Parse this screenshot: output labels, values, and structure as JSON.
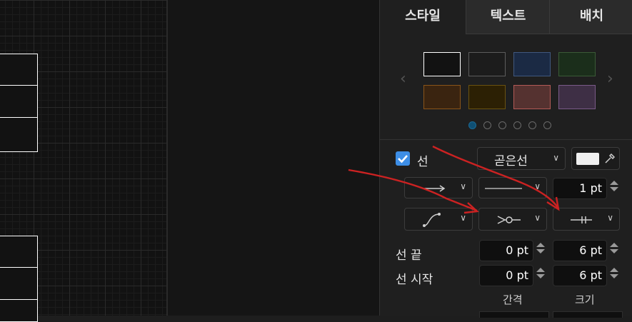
{
  "tabs": [
    {
      "label": "스타일"
    },
    {
      "label": "텍스트"
    },
    {
      "label": "배치"
    }
  ],
  "swatches": [
    {
      "fill": "#121212",
      "stroke": "#ffffff"
    },
    {
      "fill": "#1c1c1c",
      "stroke": "#5c5c5c"
    },
    {
      "fill": "#1b2a44",
      "stroke": "#40587e"
    },
    {
      "fill": "#1b2e1b",
      "stroke": "#3a5a36"
    },
    {
      "fill": "#3a2410",
      "stroke": "#8a5418"
    },
    {
      "fill": "#2c2004",
      "stroke": "#6a5210"
    },
    {
      "fill": "#553230",
      "stroke": "#b35a56"
    },
    {
      "fill": "#3e2f45",
      "stroke": "#7a5a88"
    }
  ],
  "pager": {
    "count": 6,
    "active_index": 0
  },
  "line": {
    "enabled": true,
    "label": "선",
    "style_value": "곧은선",
    "color": "#f0f0f0",
    "width_value": "1 pt"
  },
  "line_end": {
    "label": "선 끝",
    "spacing": "0 pt",
    "size": "6 pt"
  },
  "line_start": {
    "label": "선 시작",
    "spacing": "0 pt",
    "size": "6 pt"
  },
  "col_labels": {
    "spacing": "간격",
    "size": "크기"
  },
  "annotation_color": "#cc2222"
}
